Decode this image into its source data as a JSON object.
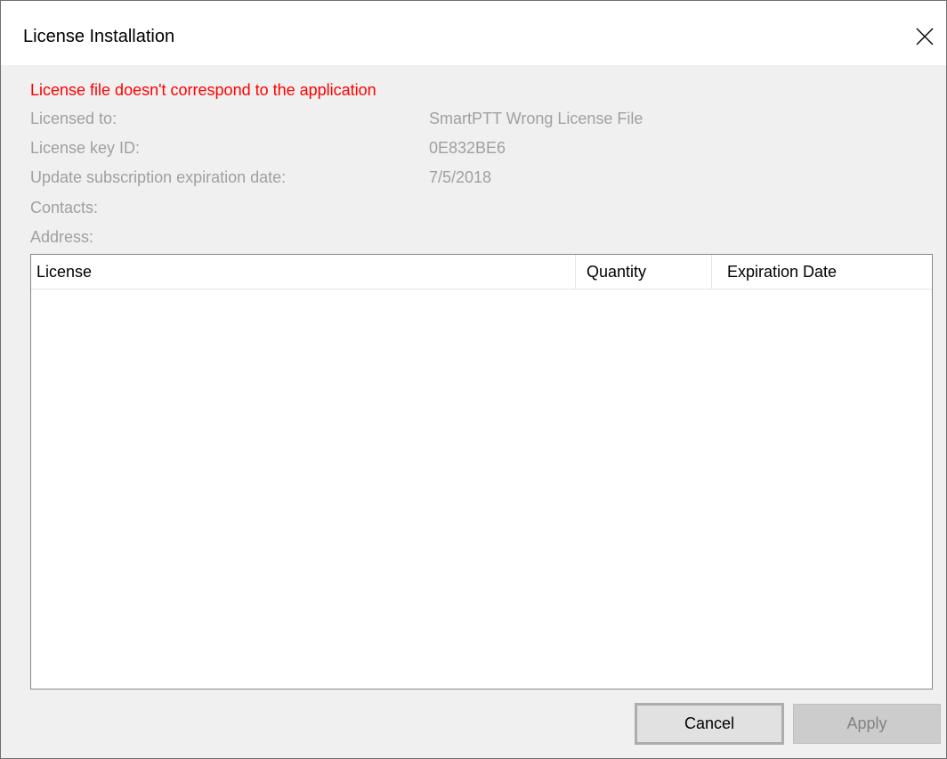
{
  "window": {
    "title": "License Installation",
    "close_icon": "close-icon"
  },
  "status": {
    "error_text": "License file doesn't correspond to the application",
    "error_color": "#ff0000"
  },
  "license_info": {
    "licensed_to_label": "Licensed to:",
    "licensed_to_value": "SmartPTT Wrong License File",
    "key_id_label": "License key ID:",
    "key_id_value": "0E832BE6",
    "update_expiration_label": "Update subscription expiration date:",
    "update_expiration_value": "7/5/2018",
    "contacts_label": "Contacts:",
    "address_label": "Address:"
  },
  "table": {
    "columns": [
      "License",
      "Quantity",
      "Expiration Date"
    ],
    "rows": []
  },
  "buttons": {
    "cancel_label": "Cancel",
    "apply_label": "Apply"
  }
}
